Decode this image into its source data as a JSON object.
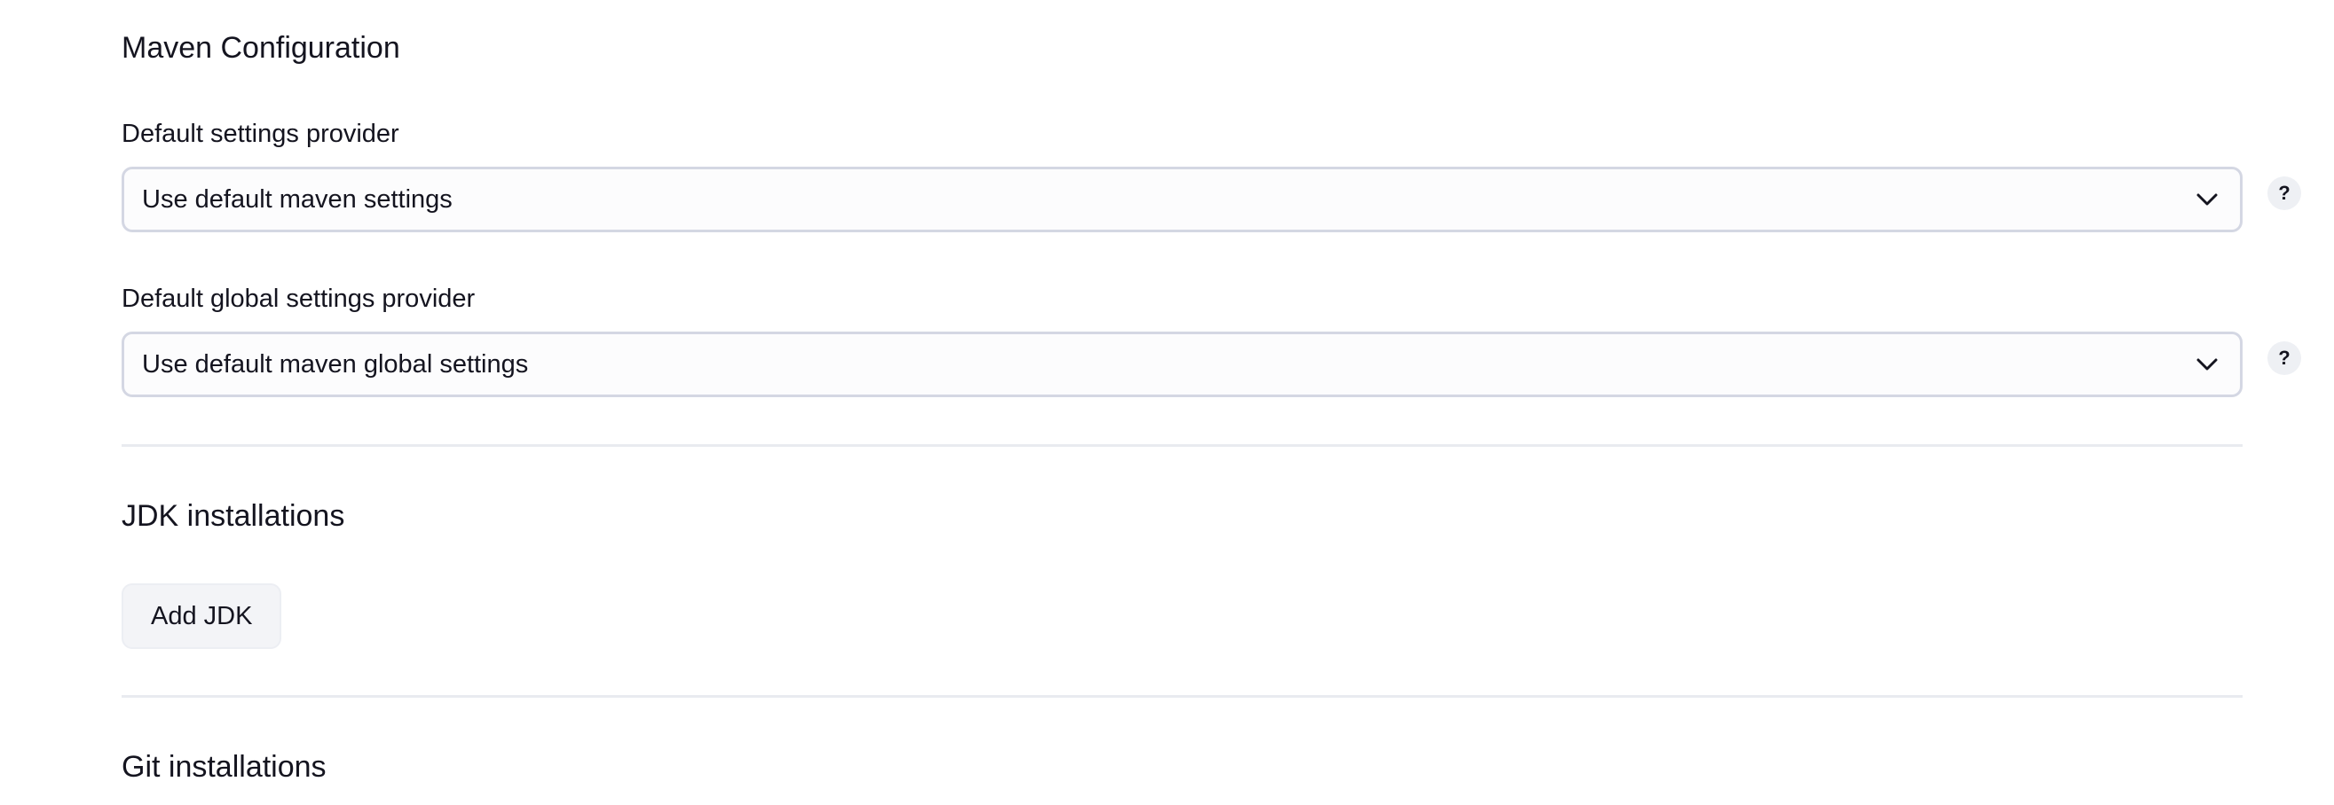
{
  "maven": {
    "title": "Maven Configuration",
    "settings_label": "Default settings provider",
    "settings_value": "Use default maven settings",
    "global_label": "Default global settings provider",
    "global_value": "Use default maven global settings",
    "help_glyph": "?"
  },
  "jdk": {
    "title": "JDK installations",
    "add_button": "Add JDK"
  },
  "git": {
    "title": "Git installations"
  },
  "colors": {
    "select_border": "#d4d7e3",
    "divider": "#e9ebf0",
    "button_bg": "#f3f4f7"
  }
}
